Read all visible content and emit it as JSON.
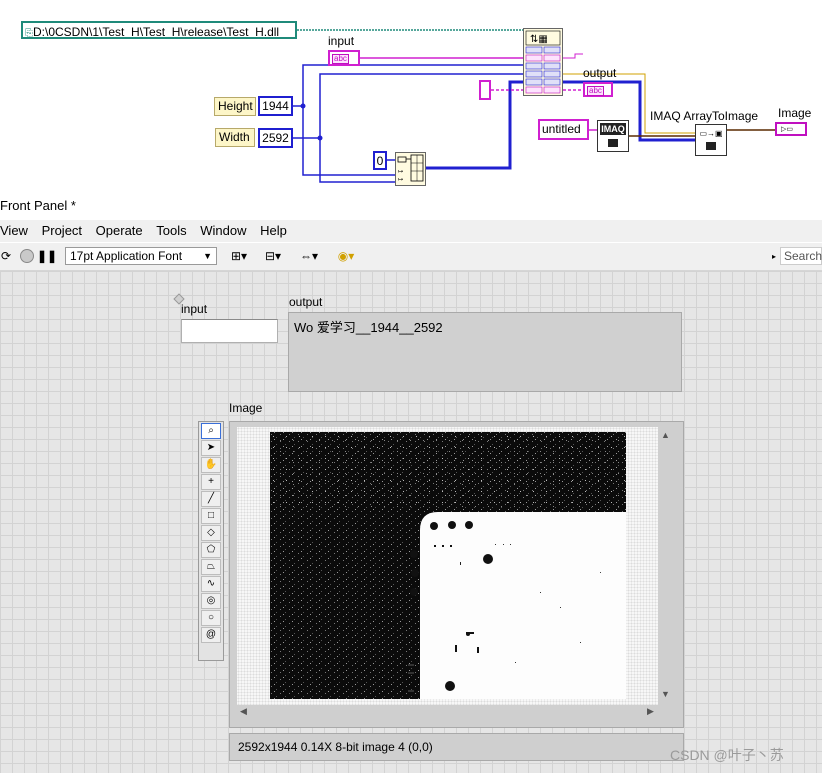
{
  "diagram": {
    "path_constant": "D:\\0CSDN\\1\\Test_H\\Test_H\\release\\Test_H.dll",
    "input_label": "input",
    "output_label": "output",
    "height_label": "Height",
    "height_value": "1944",
    "width_label": "Width",
    "width_value": "2592",
    "zero_constant": "0",
    "untitled_label": "untitled",
    "imaq_label": "IMAQ",
    "imaq_array_label": "IMAQ ArrayToImage",
    "image_label": "Image",
    "abc_icon": "abc"
  },
  "window": {
    "title": "Front Panel *"
  },
  "menu": [
    "View",
    "Project",
    "Operate",
    "Tools",
    "Window",
    "Help"
  ],
  "toolbar": {
    "font": "17pt Application Font",
    "search_placeholder": "Search"
  },
  "front_panel": {
    "input_label": "input",
    "input_value": "",
    "output_label": "output",
    "output_value": "Wo 爱学习__1944__2592",
    "image_label": "Image",
    "status": "2592x1944 0.14X 8-bit image 4    (0,0)"
  },
  "watermark": "CSDN @叶子丶苏",
  "tools": [
    "zoom-icon",
    "pointer-icon",
    "pan-hand-icon",
    "crosshair-icon",
    "line-icon",
    "rectangle-icon",
    "rotated-rect-icon",
    "polygon-icon",
    "freehand-icon",
    "freehand-line-icon",
    "annulus-icon",
    "oval-icon",
    "spiral-icon"
  ]
}
